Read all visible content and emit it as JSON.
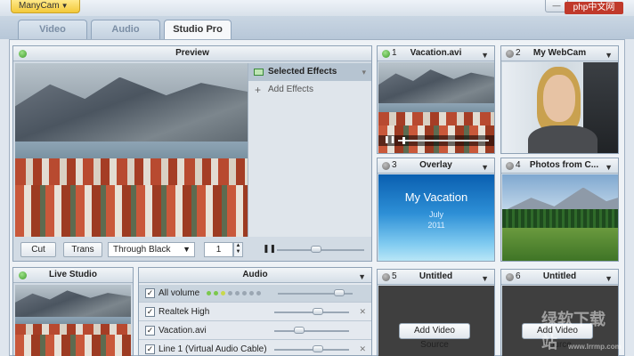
{
  "titlebar": {
    "app_menu": "ManyCam",
    "min_label": "—",
    "close_label": "php中文网"
  },
  "tabs": [
    {
      "label": "Video"
    },
    {
      "label": "Audio"
    },
    {
      "label": "Studio Pro"
    }
  ],
  "preview": {
    "title": "Preview",
    "effects": [
      {
        "label": "Selected Effects"
      },
      {
        "label": "Add Effects"
      }
    ],
    "controls": {
      "cut": "Cut",
      "trans": "Trans",
      "transition": "Through Black",
      "count": "1"
    }
  },
  "sources": [
    {
      "num": "1",
      "title": "Vacation.avi"
    },
    {
      "num": "2",
      "title": "My WebCam"
    },
    {
      "num": "3",
      "title": "Overlay"
    },
    {
      "num": "4",
      "title": "Photos from C..."
    },
    {
      "num": "5",
      "title": "Untitled",
      "button": "Add Video Source"
    },
    {
      "num": "6",
      "title": "Untitled",
      "button": "Add Video Source"
    }
  ],
  "overlay": {
    "title": "My Vacation",
    "line1": "July",
    "line2": "2011"
  },
  "live_studio": {
    "title": "Live Studio"
  },
  "audio": {
    "title": "Audio",
    "rows": [
      {
        "label": "All volume",
        "volume": 0.88
      },
      {
        "label": "Realtek High",
        "volume": 0.6
      },
      {
        "label": "Vacation.avi",
        "volume": 0.3
      },
      {
        "label": "Line 1 (Virtual Audio Cable)",
        "volume": 0.6
      }
    ]
  },
  "watermark": {
    "main": "绿软下载站",
    "sub": "www.lrrmp.com"
  },
  "colors": {
    "active_dot": "#3e9b2a",
    "inactive_dot": "#6e6e6e",
    "app_menu": "#f3c93a"
  },
  "playback": {
    "progress": 0.05
  }
}
